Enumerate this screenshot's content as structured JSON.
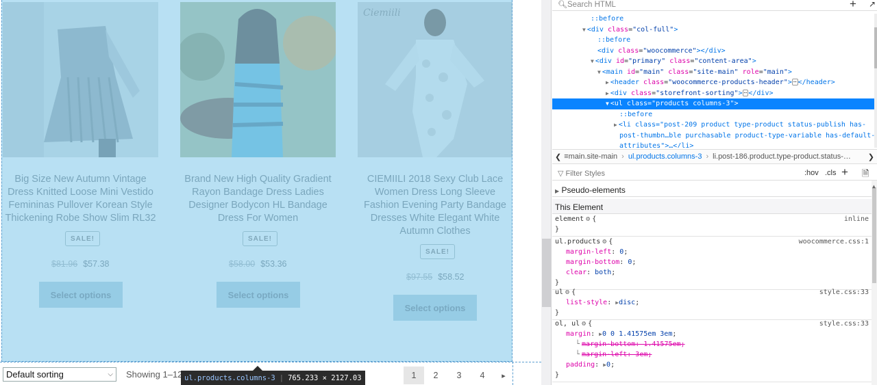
{
  "products": [
    {
      "title": "Big Size New Autumn Vintage Dress Knitted Loose Mini Vestido Femininas Pullover Korean Style Thickening Robe Show Slim RL32",
      "sale_label": "SALE!",
      "old_price": "$81.96",
      "new_price": "$57.38",
      "button_label": "Select options"
    },
    {
      "title": "Brand New High Quality Gradient Rayon Bandage Dress Ladies Designer Bodycon HL Bandage Dress For Women",
      "sale_label": "SALE!",
      "old_price": "$58.00",
      "new_price": "$53.36",
      "button_label": "Select options"
    },
    {
      "title": "CIEMIILI 2018 Sexy Club Lace Women Dress Long Sleeve Fashion Evening Party Bandage Dresses White Elegant White Autumn Clothes",
      "sale_label": "SALE!",
      "old_price": "$97.55",
      "new_price": "$58.52",
      "button_label": "Select options"
    }
  ],
  "image_watermark": "Ciemiili",
  "sorting": {
    "selected": "Default sorting"
  },
  "result_count": "Showing 1–12",
  "inspector_tip": {
    "selector": "ul.products.columns-3",
    "dimensions": "765.233 × 2127.03"
  },
  "pagination": {
    "pages": [
      "1",
      "2",
      "3",
      "4"
    ],
    "current": "1",
    "next": "▸"
  },
  "highlight_color": "#8ccdec",
  "devtools": {
    "search_placeholder": "Search HTML",
    "html_tree": [
      {
        "pseudo": "::before"
      },
      {
        "tag": "div",
        "attrs": [
          [
            "class",
            "col-full"
          ]
        ],
        "close": false
      },
      {
        "pseudo": "::before"
      },
      {
        "tag": "div",
        "attrs": [
          [
            "class",
            "woocommerce"
          ]
        ],
        "close": true,
        "inline_close": "</div>"
      },
      {
        "tag": "div",
        "attrs": [
          [
            "id",
            "primary"
          ],
          [
            "class",
            "content-area"
          ]
        ],
        "close": false
      },
      {
        "tag": "main",
        "attrs": [
          [
            "id",
            "main"
          ],
          [
            "class",
            "site-main"
          ],
          [
            "role",
            "main"
          ]
        ],
        "close": false
      },
      {
        "tag": "header",
        "attrs": [
          [
            "class",
            "woocommerce-products-header"
          ]
        ],
        "tail": "</header>"
      },
      {
        "tag": "div",
        "attrs": [
          [
            "class",
            "storefront-sorting"
          ]
        ],
        "tail": "</div>"
      },
      {
        "tag": "ul",
        "attrs": [
          [
            "class",
            "products columns-3"
          ]
        ],
        "close": false,
        "selected": true
      },
      {
        "pseudo": "::before"
      },
      {
        "text": "<li class=\"post-209 product type-product status-publish has-"
      },
      {
        "text": "post-thumbn…ble purchasable product-type-variable has-default-"
      },
      {
        "text": "attributes\">…</li>"
      }
    ],
    "breadcrumb": [
      {
        "label": "≡main.site-main",
        "active": false
      },
      {
        "label": "ul.products.columns-3",
        "active": true
      },
      {
        "label": "li.post-186.product.type-product.status-…",
        "active": false
      }
    ],
    "filter_placeholder": "Filter Styles",
    "hov_label": ":hov",
    "cls_label": ".cls",
    "pseudo_elements_label": "Pseudo-elements",
    "this_element_label": "This Element",
    "rules": [
      {
        "selector": "element",
        "source": "inline",
        "decls": []
      },
      {
        "selector": "ul.products",
        "source": "woocommerce.css:1",
        "decls": [
          {
            "prop": "margin-left",
            "value": "0"
          },
          {
            "prop": "margin-bottom",
            "value": "0"
          },
          {
            "prop": "clear",
            "value": "both"
          }
        ]
      },
      {
        "selector": "ul",
        "source": "style.css:33",
        "decls": [
          {
            "prop": "list-style",
            "value": "disc",
            "expandable": true
          }
        ]
      },
      {
        "selector": "ol, ul",
        "source": "style.css:33",
        "decls": [
          {
            "prop": "margin",
            "value": "0 0 1.41575em 3em",
            "expandable": true
          },
          {
            "prop": "margin-bottom",
            "value": "1.41575em",
            "overridden": true,
            "sub": true
          },
          {
            "prop": "margin-left",
            "value": "3em",
            "overridden": true,
            "sub": true
          },
          {
            "prop": "padding",
            "value": "0",
            "expandable": true
          }
        ]
      }
    ]
  }
}
